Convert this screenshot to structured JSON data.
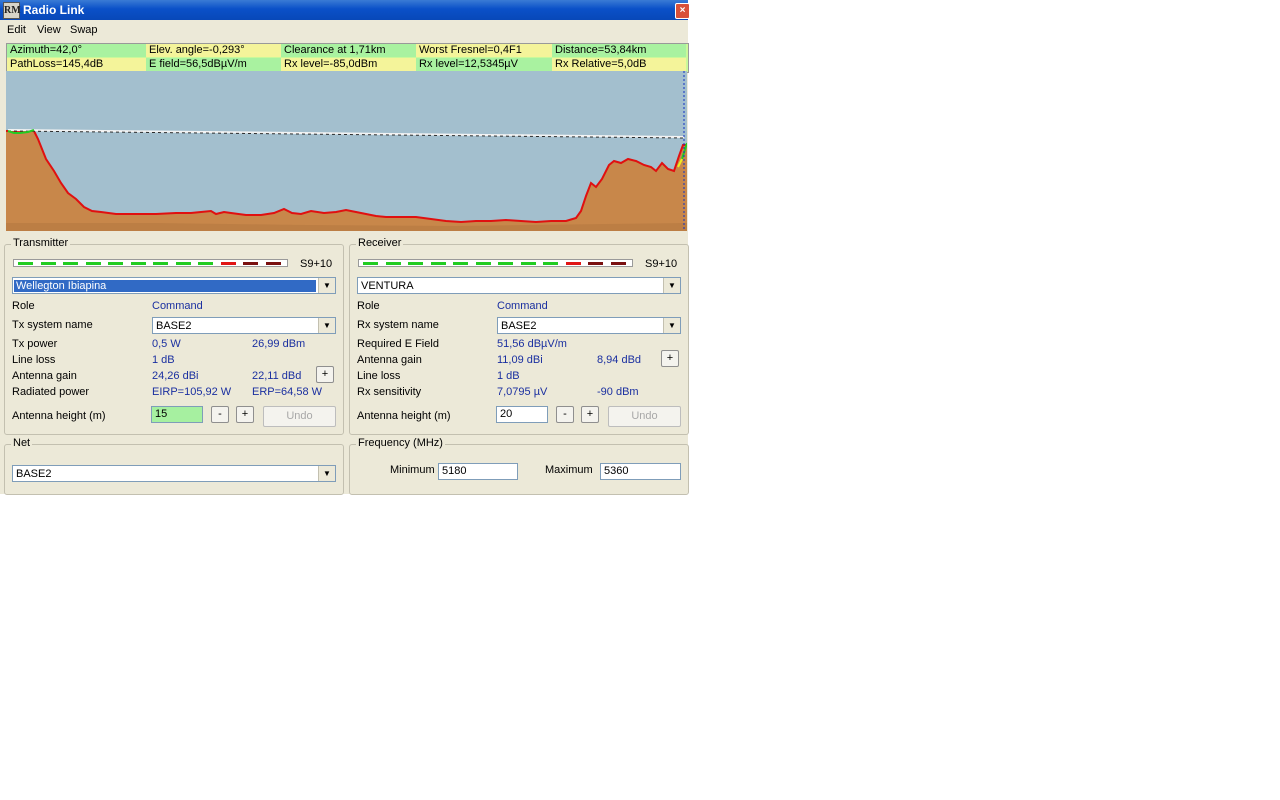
{
  "window": {
    "title": "Radio Link",
    "icon": "radio-mobile-app-icon",
    "close": "×"
  },
  "menu": [
    "Edit",
    "View",
    "Swap"
  ],
  "info_row1": [
    "Azimuth=42,0°",
    "Elev. angle=-0,293°",
    "Clearance at 1,71km",
    "Worst Fresnel=0,4F1",
    "Distance=53,84km"
  ],
  "info_row2": [
    "PathLoss=145,4dB",
    "E field=56,5dBµV/m",
    "Rx level=-85,0dBm",
    "Rx level=12,5345µV",
    "Rx Relative=5,0dB"
  ],
  "colors": {
    "sky": "#a3bfce",
    "terrain": "#c8874a",
    "terrain_edge": "#e01010",
    "info_green": "#a9f2a0",
    "info_yellow": "#f4f49a",
    "meter_green": "#22cc22",
    "meter_red": "#e01515",
    "meter_darkred": "#7a1010"
  },
  "transmitter": {
    "title": "Transmitter",
    "signal": "S9+10",
    "station": "Wellegton Ibiapina",
    "role_label": "Role",
    "role_value": "Command",
    "system_label": "Tx system name",
    "system_value": "BASE2",
    "power_label": "Tx power",
    "power_w": "0,5 W",
    "power_dbm": "26,99 dBm",
    "lineloss_label": "Line loss",
    "lineloss_value": "1 dB",
    "gain_label": "Antenna gain",
    "gain_dbi": "24,26 dBi",
    "gain_dbd": "22,11 dBd",
    "radiated_label": "Radiated power",
    "eirp": "EIRP=105,92 W",
    "erp": "ERP=64,58 W",
    "height_label": "Antenna height (m)",
    "height_value": "15",
    "minus": "-",
    "plus": "+",
    "undo": "Undo"
  },
  "receiver": {
    "title": "Receiver",
    "signal": "S9+10",
    "station": "VENTURA",
    "role_label": "Role",
    "role_value": "Command",
    "system_label": "Rx system name",
    "system_value": "BASE2",
    "efield_label": "Required E Field",
    "efield_value": "51,56 dBµV/m",
    "gain_label": "Antenna gain",
    "gain_dbi": "11,09 dBi",
    "gain_dbd": "8,94 dBd",
    "lineloss_label": "Line loss",
    "lineloss_value": "1 dB",
    "sens_label": "Rx sensitivity",
    "sens_uv": "7,0795 µV",
    "sens_dbm": "-90 dBm",
    "height_label": "Antenna height (m)",
    "height_value": "20",
    "minus": "-",
    "plus": "+",
    "undo": "Undo"
  },
  "net": {
    "title": "Net",
    "value": "BASE2"
  },
  "frequency": {
    "title": "Frequency (MHz)",
    "min_label": "Minimum",
    "min_value": "5180",
    "max_label": "Maximum",
    "max_value": "5360"
  },
  "meter_segments": [
    "green",
    "green",
    "green",
    "green",
    "green",
    "green",
    "green",
    "green",
    "green",
    "red",
    "darkred",
    "darkred"
  ]
}
